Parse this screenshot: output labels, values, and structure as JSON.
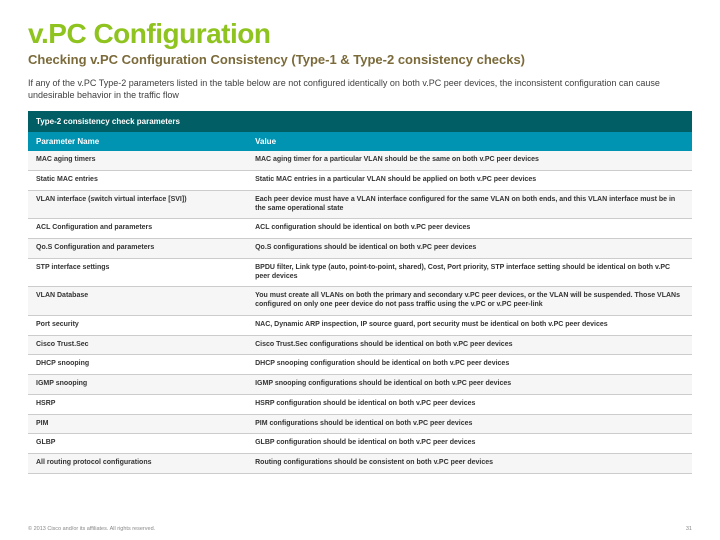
{
  "title": "v.PC Configuration",
  "subtitle": "Checking v.PC Configuration Consistency (Type-1 & Type-2 consistency checks)",
  "intro": "If any of the v.PC Type-2 parameters listed in the table below are not configured identically on both v.PC peer devices, the inconsistent configuration can cause undesirable behavior in the traffic flow",
  "table": {
    "section_header": "Type-2 consistency check parameters",
    "col1": "Parameter Name",
    "col2": "Value",
    "rows": [
      {
        "name": "MAC aging timers",
        "value": "MAC aging timer for a particular VLAN should be the same on both v.PC peer devices"
      },
      {
        "name": "Static MAC entries",
        "value": "Static MAC entries in a particular VLAN should be applied on both v.PC peer devices"
      },
      {
        "name": "VLAN interface (switch virtual interface [SVI])",
        "value": "Each peer device must have a VLAN interface configured for the same VLAN on both ends, and this VLAN interface must be in the same operational state"
      },
      {
        "name": "ACL Configuration and parameters",
        "value": "ACL configuration should be identical on both v.PC peer devices"
      },
      {
        "name": "Qo.S Configuration and parameters",
        "value": "Qo.S configurations should be identical on both v.PC peer devices"
      },
      {
        "name": "STP interface settings",
        "value": "BPDU filter, Link type (auto, point-to-point, shared), Cost, Port priority, STP interface setting should be identical on both v.PC peer devices"
      },
      {
        "name": "VLAN Database",
        "value": "You must create all VLANs on both the primary and secondary v.PC peer devices, or the VLAN will be suspended. Those VLANs configured on only one peer device do not pass traffic using the v.PC or v.PC peer-link"
      },
      {
        "name": "Port security",
        "value": "NAC, Dynamic ARP inspection, IP source guard, port security must be identical on both v.PC peer devices"
      },
      {
        "name": "Cisco Trust.Sec",
        "value": "Cisco Trust.Sec configurations should be identical on both v.PC peer devices"
      },
      {
        "name": "DHCP snooping",
        "value": "DHCP snooping configuration should be identical on both v.PC peer devices"
      },
      {
        "name": "IGMP snooping",
        "value": "IGMP snooping configurations should be identical on both v.PC peer devices"
      },
      {
        "name": "HSRP",
        "value": "HSRP configuration should be identical on both v.PC peer devices"
      },
      {
        "name": "PIM",
        "value": "PIM configurations should be identical on both v.PC peer devices"
      },
      {
        "name": "GLBP",
        "value": "GLBP configuration should be identical on both v.PC peer devices"
      },
      {
        "name": "All routing protocol configurations",
        "value": "Routing configurations should be consistent on both v.PC peer devices"
      }
    ]
  },
  "footer": {
    "left": "© 2013 Cisco and/or its affiliates. All rights reserved.",
    "right": "31"
  }
}
